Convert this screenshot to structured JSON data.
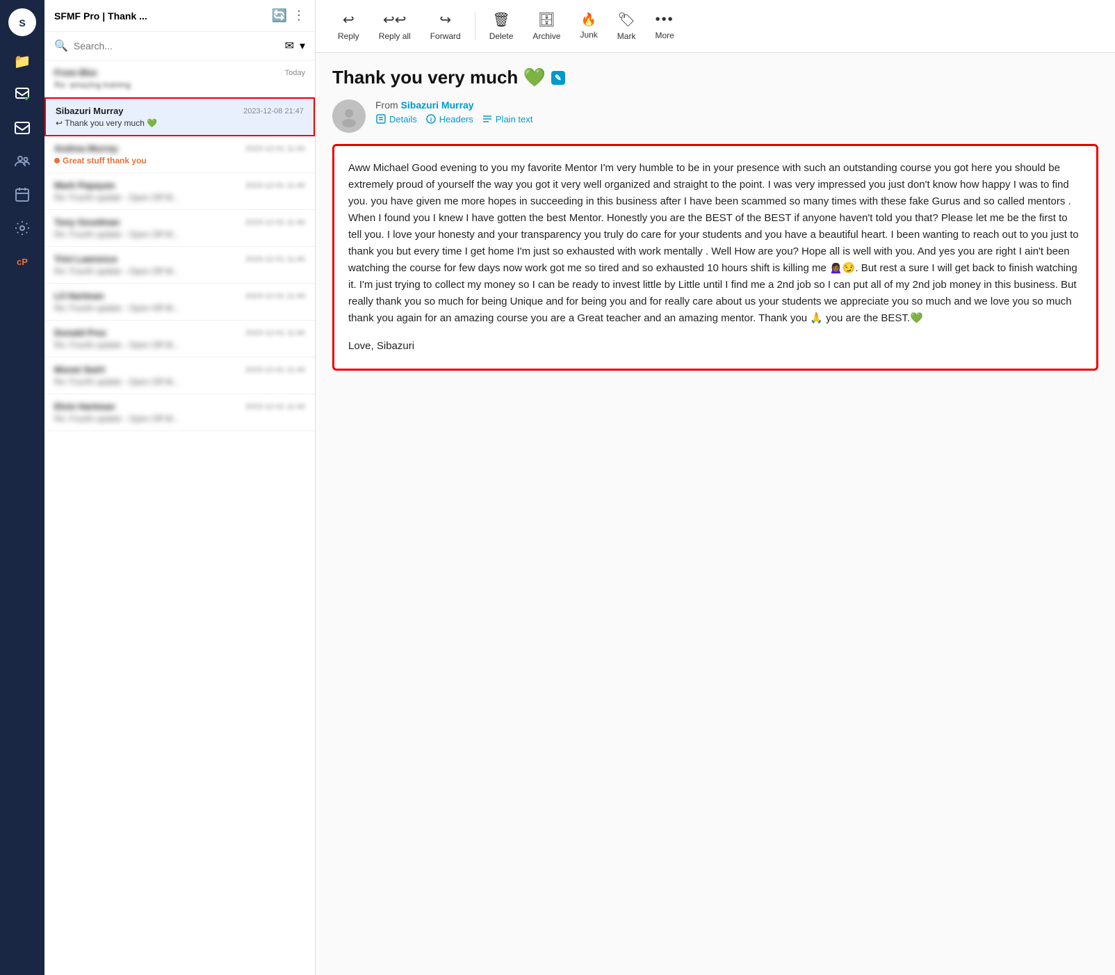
{
  "sidebar": {
    "logo_text": "S",
    "nav_items": [
      {
        "name": "folder-icon",
        "icon": "📁",
        "active": false
      },
      {
        "name": "compose-icon",
        "icon": "✏️",
        "active": true
      },
      {
        "name": "email-icon",
        "icon": "✉️",
        "active": false
      },
      {
        "name": "contacts-icon",
        "icon": "👥",
        "active": false
      },
      {
        "name": "calendar-icon",
        "icon": "📅",
        "active": false
      },
      {
        "name": "settings-icon",
        "icon": "⚙️",
        "active": false
      },
      {
        "name": "cp-icon",
        "icon": "cP",
        "active": false,
        "orange": true
      }
    ]
  },
  "panel": {
    "title": "SFMF Pro | Thank ...",
    "search_placeholder": "Search...",
    "emails": [
      {
        "id": "blurred-1",
        "sender": "From Blur",
        "date": "Today",
        "subject": "Re: amazing training",
        "blurred": false,
        "subject_blurred": false
      },
      {
        "id": "selected",
        "sender": "Sibazuri Murray",
        "date": "2023-12-08 21:47",
        "subject": "↩ Thank you very much 💚",
        "selected": true,
        "blurred": false,
        "subject_blurred": false
      },
      {
        "id": "blurred-2",
        "sender": "Andrea Murray",
        "date": "2023-12-01 11:40",
        "subject": "Great stuff thank you",
        "has_dot": true,
        "blurred": true,
        "subject_blurred": false,
        "subject_color": "orange"
      },
      {
        "id": "blurred-3",
        "sender": "Mark Papayan",
        "date": "2023-12-01 11:40",
        "subject": "Re: Fourth update - Open Off W...",
        "has_dot": false,
        "blurred": true
      },
      {
        "id": "blurred-4",
        "sender": "Tony Goodman",
        "date": "2023-12-01 11:40",
        "subject": "Re: Fourth update - Open Off W...",
        "has_dot": false,
        "blurred": true
      },
      {
        "id": "blurred-5",
        "sender": "Trini Lawrence",
        "date": "2023-12-01 11:40",
        "subject": "Re: Fourth update - Open Off W...",
        "has_dot": false,
        "blurred": true
      },
      {
        "id": "blurred-6",
        "sender": "Lil Hartman",
        "date": "2023-12-01 11:40",
        "subject": "Re: Fourth update - Open Off W...",
        "has_dot": false,
        "blurred": true
      },
      {
        "id": "blurred-7",
        "sender": "Donald Prez",
        "date": "2023-12-01 11:40",
        "subject": "Re: Fourth update - Open Off W...",
        "has_dot": false,
        "blurred": true
      },
      {
        "id": "blurred-8",
        "sender": "Monet Swirl",
        "date": "2023-12-01 11:40",
        "subject": "Re: Fourth update - Open Off W...",
        "has_dot": false,
        "blurred": true
      },
      {
        "id": "blurred-9",
        "sender": "Elvin Hartman",
        "date": "2023-12-01 11:40",
        "subject": "Re: Fourth update - Open Off W...",
        "has_dot": false,
        "blurred": true
      }
    ]
  },
  "toolbar": {
    "buttons": [
      {
        "name": "reply-button",
        "icon": "↩",
        "label": "Reply"
      },
      {
        "name": "reply-all-button",
        "icon": "↩↩",
        "label": "Reply all"
      },
      {
        "name": "forward-button",
        "icon": "↪",
        "label": "Forward"
      },
      {
        "name": "delete-button",
        "icon": "🗑",
        "label": "Delete"
      },
      {
        "name": "archive-button",
        "icon": "🗄",
        "label": "Archive"
      },
      {
        "name": "junk-button",
        "icon": "🔥",
        "label": "Junk"
      },
      {
        "name": "mark-button",
        "icon": "🏷",
        "label": "Mark"
      },
      {
        "name": "more-button",
        "icon": "•••",
        "label": "More"
      }
    ]
  },
  "email": {
    "subject": "Thank you very much 💚",
    "edit_icon": "✎",
    "from_label": "From",
    "from_name": "Sibazuri Murray",
    "details_label": "Details",
    "headers_label": "Headers",
    "plain_text_label": "Plain text",
    "body": "Aww Michael Good evening to you my favorite Mentor I'm very humble to be in your presence with such an outstanding course you got here you should be extremely proud of yourself the way you got it very well organized and straight to the point.  I was very impressed you just don't know how happy I was to find you.  you have given me more hopes in succeeding in this business after I have been scammed so many times with these fake Gurus and so called mentors . When I found you I knew I have gotten the best Mentor. Honestly you are the BEST of the BEST if anyone haven't told you that? Please let me be the first to tell you. I love your honesty and your transparency you truly do care for your students and you have a beautiful heart. I been wanting to reach out to you just to thank you but every time I get home I'm just so exhausted with work mentally .  Well  How are you? Hope all is well with you. And yes you are right I ain't been watching the course for few days now work got me so tired and so exhausted 10 hours shift is killing me 🙍🏾‍♀️😏. But rest a sure I will get back to finish watching it. I'm just trying to collect my money so I can be ready to invest little by Little until I find me a 2nd job so I can put all of my 2nd job money in this business. But really  thank you so much for being Unique and for being you and for really care about us your students we appreciate you so much and we love you so much thank you again for an amazing course you are a Great teacher and an amazing mentor.  Thank you 🙏 you are the BEST.💚",
    "sign_off": "Love, Sibazuri"
  }
}
